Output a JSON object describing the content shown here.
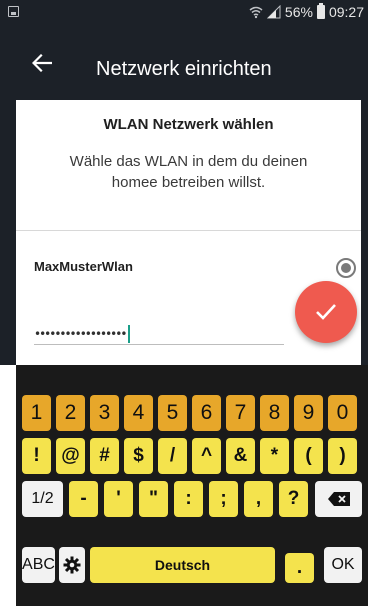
{
  "status_bar": {
    "battery_text": "56%",
    "time": "09:27",
    "icons": [
      "picture-icon",
      "wifi-icon",
      "signal-icon",
      "battery-icon"
    ]
  },
  "app_bar": {
    "title": "Netzwerk einrichten",
    "back_icon": "back-arrow-icon"
  },
  "content": {
    "section_title": "WLAN Netzwerk wählen",
    "description": "Wähle das WLAN in dem du deinen homee betreiben willst.",
    "network_name": "MaxMusterWlan",
    "password_masked": "••••••••••••••••••",
    "fab_icon": "check-icon"
  },
  "keyboard": {
    "row1": [
      "1",
      "2",
      "3",
      "4",
      "5",
      "6",
      "7",
      "8",
      "9",
      "0"
    ],
    "row2": [
      "!",
      "@",
      "#",
      "$",
      "/",
      "^",
      "&",
      "*",
      "(",
      ")"
    ],
    "row3": [
      "1/2",
      "-",
      "'",
      "\"",
      ":",
      ";",
      ",",
      "?"
    ],
    "row4": {
      "abc": "ABC",
      "space": "Deutsch",
      "dot": ".",
      "ok": "OK"
    },
    "icons": [
      "backspace-icon",
      "settings-icon"
    ]
  },
  "colors": {
    "app_bar": "#1c2128",
    "accent_fab": "#ef5a4f",
    "caret": "#1a9e89",
    "digit_keys": "#e7a72a",
    "symbol_keys": "#f4e34d"
  }
}
